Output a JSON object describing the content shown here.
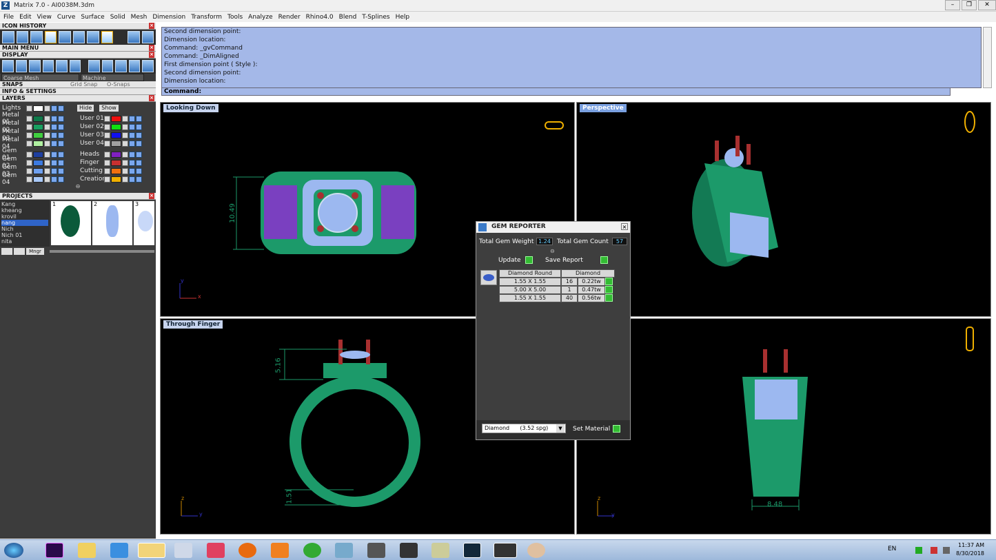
{
  "app": {
    "title": "Matrix 7.0 - AI0038M.3dm",
    "icon_letter": "Z"
  },
  "window_buttons": [
    "–",
    "❐",
    "✕"
  ],
  "menu": [
    "File",
    "Edit",
    "View",
    "Curve",
    "Surface",
    "Solid",
    "Mesh",
    "Dimension",
    "Transform",
    "Tools",
    "Analyze",
    "Render",
    "Rhino4.0",
    "Blend",
    "T-Splines",
    "Help"
  ],
  "panels": {
    "icon_history": "ICON HISTORY",
    "main_menu": "MAIN MENU",
    "display": "DISPLAY",
    "snaps": "SNAPS",
    "grid_snap": "Grid Snap",
    "o_snaps": "O-Snaps",
    "info": "INFO & SETTINGS",
    "layers": "LAYERS",
    "projects": "PROJECTS"
  },
  "display": {
    "mesh": "Coarse Mesh",
    "material": "Machine"
  },
  "layers": {
    "lights": "Lights",
    "hide": "Hide",
    "show": "Show",
    "left": [
      {
        "name": "Metal 01",
        "color": "#0f7a4a"
      },
      {
        "name": "Metal 02",
        "color": "#18a060"
      },
      {
        "name": "Metal 03",
        "color": "#3fce3f"
      },
      {
        "name": "Metal 04",
        "color": "#b0f0a0"
      },
      {
        "name": "Gem 01",
        "color": "#1e3fa0"
      },
      {
        "name": "Gem 02",
        "color": "#3c7ae0"
      },
      {
        "name": "Gem 03",
        "color": "#6ea0f0"
      },
      {
        "name": "Gem 04",
        "color": "#a8c8f8"
      }
    ],
    "right": [
      {
        "name": "User 01",
        "color": "#ee1010"
      },
      {
        "name": "User 02",
        "color": "#10e010"
      },
      {
        "name": "User 03",
        "color": "#1010ee"
      },
      {
        "name": "User 04",
        "color": "#a0a0a0"
      },
      {
        "name": "Heads",
        "color": "#8020c0"
      },
      {
        "name": "Finger",
        "color": "#c83030"
      },
      {
        "name": "Cutting",
        "color": "#f07010"
      },
      {
        "name": "Creation",
        "color": "#f0b000"
      }
    ]
  },
  "projects": {
    "names": [
      "Kang",
      "kheang",
      "krovil",
      "nang",
      "Nich",
      "Nich 01",
      "nita"
    ],
    "selected": "nang",
    "thumbs": [
      "1",
      "2",
      "3"
    ],
    "mngr": "Mngr"
  },
  "command_history": [
    "Second dimension point:",
    "Dimension location:",
    "Command: _gvCommand",
    "Command: _DimAligned",
    "First dimension point ( Style ):",
    "Second dimension point:",
    "Dimension location:"
  ],
  "command_prompt": "Command:",
  "viewports": {
    "top_left": "Looking Down",
    "top_right": "Perspective",
    "bottom_left": "Through Finger"
  },
  "dimensions": {
    "d1": "10.49",
    "d2": "5.16",
    "d3": "1.51",
    "d4": "8.48"
  },
  "axes": {
    "x": "x",
    "y": "y",
    "z": "z"
  },
  "gem_reporter": {
    "title": "GEM REPORTER",
    "weight_label": "Total Gem Weight",
    "weight": "1.24",
    "count_label": "Total Gem Count",
    "count": "57",
    "update": "Update",
    "save": "Save Report",
    "col1": "Diamond Round",
    "col2": "Diamond",
    "rows": [
      {
        "size": "1.55 X 1.55",
        "qty": "16",
        "wt": "0.22tw"
      },
      {
        "size": "5.00 X 5.00",
        "qty": "1",
        "wt": "0.47tw"
      },
      {
        "size": "1.55 X 1.55",
        "qty": "40",
        "wt": "0.56tw"
      }
    ],
    "material": "Diamond      (3.52 spg)",
    "set_material": "Set Material"
  },
  "tray": {
    "lang": "EN",
    "time": "11:37 AM",
    "date": "8/30/2018"
  },
  "colors": {
    "metal": "#1c9a6a",
    "gem": "#9cb8f0",
    "prong": "#a83030",
    "accent": "#a4b8e8"
  }
}
